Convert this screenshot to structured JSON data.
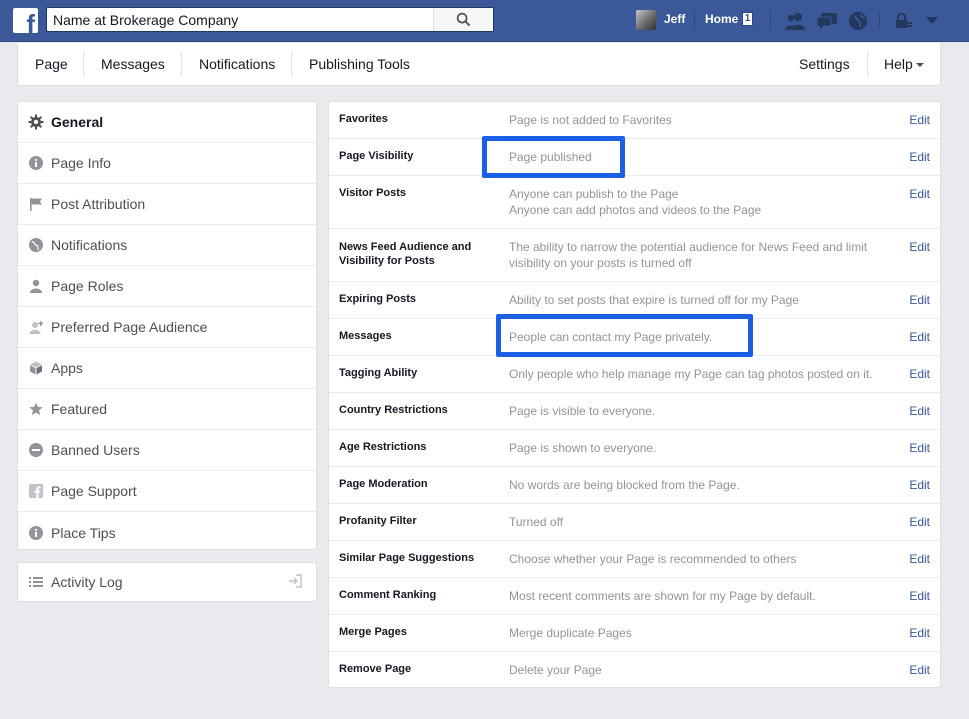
{
  "topbar": {
    "search_value": "Name at Brokerage Company",
    "user_name": "Jeff",
    "home_label": "Home",
    "home_badge": "1"
  },
  "page_nav": {
    "items": [
      "Page",
      "Messages",
      "Notifications",
      "Publishing Tools"
    ],
    "settings_label": "Settings",
    "help_label": "Help"
  },
  "sidebar": {
    "items": [
      {
        "label": "General",
        "icon": "gear-icon",
        "active": true
      },
      {
        "label": "Page Info",
        "icon": "info-icon"
      },
      {
        "label": "Post Attribution",
        "icon": "flag-icon"
      },
      {
        "label": "Notifications",
        "icon": "globe-icon"
      },
      {
        "label": "Page Roles",
        "icon": "person-icon"
      },
      {
        "label": "Preferred Page Audience",
        "icon": "audience-icon"
      },
      {
        "label": "Apps",
        "icon": "cube-icon"
      },
      {
        "label": "Featured",
        "icon": "star-icon"
      },
      {
        "label": "Banned Users",
        "icon": "ban-icon"
      },
      {
        "label": "Page Support",
        "icon": "facebook-icon"
      },
      {
        "label": "Place Tips",
        "icon": "info-icon"
      }
    ],
    "activity_log": "Activity Log"
  },
  "settings": {
    "edit_label": "Edit",
    "rows": [
      {
        "name": "Favorites",
        "desc": [
          "Page is not added to Favorites"
        ]
      },
      {
        "name": "Page Visibility",
        "desc": [
          "Page published"
        ]
      },
      {
        "name": "Visitor Posts",
        "desc": [
          "Anyone can publish to the Page",
          "Anyone can add photos and videos to the Page"
        ]
      },
      {
        "name": "News Feed Audience and Visibility for Posts",
        "desc": [
          "The ability to narrow the potential audience for News Feed and limit visibility on your posts is turned off"
        ]
      },
      {
        "name": "Expiring Posts",
        "desc": [
          "Ability to set posts that expire is turned off for my Page"
        ]
      },
      {
        "name": "Messages",
        "desc": [
          "People can contact my Page privately."
        ]
      },
      {
        "name": "Tagging Ability",
        "desc": [
          "Only people who help manage my Page can tag photos posted on it."
        ]
      },
      {
        "name": "Country Restrictions",
        "desc": [
          "Page is visible to everyone."
        ]
      },
      {
        "name": "Age Restrictions",
        "desc": [
          "Page is shown to everyone."
        ]
      },
      {
        "name": "Page Moderation",
        "desc": [
          "No words are being blocked from the Page."
        ]
      },
      {
        "name": "Profanity Filter",
        "desc": [
          "Turned off"
        ]
      },
      {
        "name": "Similar Page Suggestions",
        "desc": [
          "Choose whether your Page is recommended to others"
        ]
      },
      {
        "name": "Comment Ranking",
        "desc": [
          "Most recent comments are shown for my Page by default."
        ]
      },
      {
        "name": "Merge Pages",
        "desc": [
          "Merge duplicate Pages"
        ]
      },
      {
        "name": "Remove Page",
        "desc": [
          "Delete your Page"
        ]
      }
    ]
  },
  "colors": {
    "brand_blue": "#3b5998",
    "highlight": "#1a5fe6",
    "link": "#365899"
  }
}
